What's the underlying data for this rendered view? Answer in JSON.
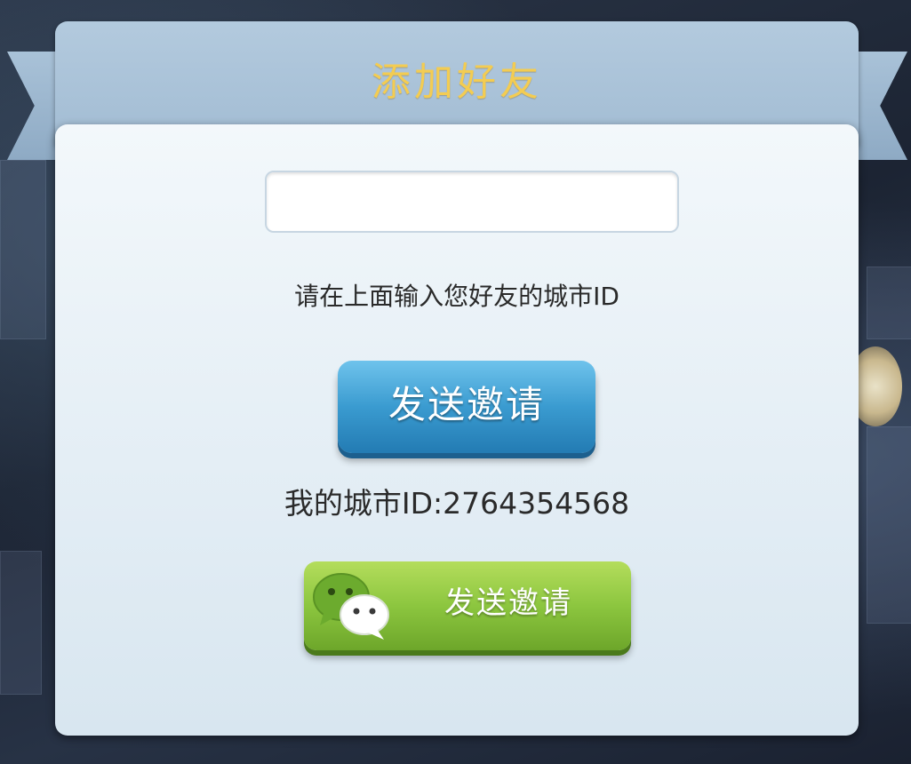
{
  "dialog": {
    "title": "添加好友"
  },
  "friend_id_input": {
    "value": "",
    "placeholder": ""
  },
  "hint_text": "请在上面输入您好友的城市ID",
  "invite_button": {
    "label": "发送邀请",
    "color": "#3a9bd0"
  },
  "my_city_id": "我的城市ID:2764354568",
  "wechat_invite_button": {
    "label": "发送邀请",
    "icon": "wechat-icon",
    "color": "#8cc63f"
  },
  "colors": {
    "title": "#f3cc52",
    "header": "#a2bcd3",
    "panel": "#e4eef5"
  }
}
